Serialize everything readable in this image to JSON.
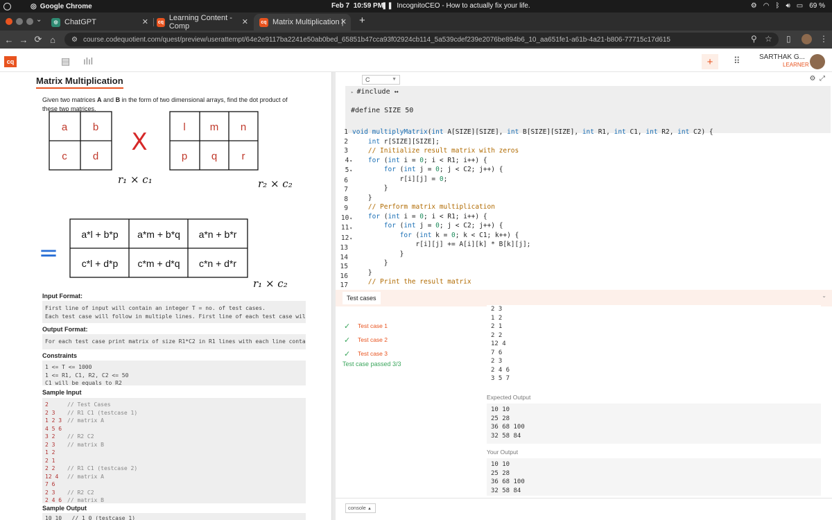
{
  "os": {
    "app_name": "Google Chrome",
    "date": "Feb 7",
    "time": "10:59 PM",
    "media": "IncognitoCEO - How to actually fix your life.",
    "battery": "69 %"
  },
  "tabs": [
    {
      "label": "ChatGPT",
      "icon": "chatgpt-icon",
      "favcolor": "#2f8a72"
    },
    {
      "label": "Learning Content - Comp",
      "icon": "cq-icon",
      "favcolor": "#e8531f"
    },
    {
      "label": "Matrix Multiplication | C",
      "icon": "cq-icon",
      "favcolor": "#e8531f"
    }
  ],
  "address": {
    "url": "course.codequotient.com/quest/preview/userattempt/64e2e9117ba2241e50ab0bed_65851b47cca93f02924cb114_5a539cdef239e2076be894b6_10_aa651fe1-a61b-4a21-b806-77715c17d615"
  },
  "header": {
    "logo": "cq",
    "user_name": "SARTHAK G...",
    "user_role": "LEARNER",
    "plus": "+"
  },
  "problem": {
    "title": "Matrix Multiplication",
    "description_a": "Given two matrices ",
    "bold_a": "A",
    "description_b": " and ",
    "bold_b": "B",
    "description_c": " in the form of two dimensional arrays, find the dot product of these two matrices.",
    "matrix_a": [
      "a",
      "b",
      "c",
      "d"
    ],
    "matrix_b": [
      "l",
      "m",
      "n",
      "p",
      "q",
      "r"
    ],
    "result": [
      "a*l + b*p",
      "a*m + b*q",
      "a*n + b*r",
      "c*l + d*p",
      "c*m + d*q",
      "c*n + d*r"
    ],
    "note_a": "r₁ × c₁",
    "note_b": "r₂ × c₂",
    "note_res": "r₁ × c₂",
    "times": "X",
    "equals": "=",
    "input_format_label": "Input Format:",
    "input_format_1": "First line of input will contain an integer T = no. of test cases.",
    "input_format_2": "Each test case will follow in multiple lines. First line of each test case will conta",
    "output_format_label": "Output Format:",
    "output_format_1": "For each test case print matrix of size R1*C2 in R1 lines with each line containing C2",
    "constraints_label": "Constraints",
    "constraints": [
      "1 <= T <= 1000",
      "1 <= R1, C1, R2, C2 <= 50",
      "C1 will be equals to R2"
    ],
    "sample_input_label": "Sample Input",
    "sample_input": [
      {
        "v": "2",
        "c": "// Test Cases"
      },
      {
        "v": "2 3",
        "c": "// R1 C1 (testcase 1)"
      },
      {
        "v": "1 2 3",
        "c": "// matrix A"
      },
      {
        "v": "4 5 6",
        "c": ""
      },
      {
        "v": "3 2",
        "c": "// R2 C2"
      },
      {
        "v": "2 3",
        "c": "// matrix B"
      },
      {
        "v": "1 2",
        "c": ""
      },
      {
        "v": "2 1",
        "c": ""
      },
      {
        "v": "2 2",
        "c": "// R1 C1 (testcase 2)"
      },
      {
        "v": "12 4",
        "c": "// matrix A"
      },
      {
        "v": "7 6",
        "c": ""
      },
      {
        "v": "2 3",
        "c": "// R2 C2"
      },
      {
        "v": "2 4 6",
        "c": "// matrix B"
      },
      {
        "v": "3 5 7",
        "c": ""
      }
    ],
    "sample_output_label": "Sample Output",
    "sample_output_first": "10 10   // 1 0 (testcase 1)"
  },
  "editor": {
    "language": "C",
    "header_lines": [
      "#include ↔",
      "",
      "#define SIZE 50"
    ],
    "code": [
      "void multiplyMatrix(int A[SIZE][SIZE], int B[SIZE][SIZE], int R1, int C1, int R2, int C2) {",
      "    int r[SIZE][SIZE];",
      "    // Initialize result matrix with zeros",
      "    for (int i = 0; i < R1; i++) {",
      "        for (int j = 0; j < C2; j++) {",
      "            r[i][j] = 0;",
      "        }",
      "    }",
      "    // Perform matrix multiplication",
      "    for (int i = 0; i < R1; i++) {",
      "        for (int j = 0; j < C2; j++) {",
      "            for (int k = 0; k < C1; k++) {",
      "                r[i][j] += A[i][k] * B[k][j];",
      "            }",
      "        }",
      "    }",
      "    // Print the result matrix"
    ],
    "folds": [
      4,
      5,
      10,
      11,
      12
    ]
  },
  "tests": {
    "tab_label": "Test cases",
    "items": [
      "Test case 1",
      "Test case 2",
      "Test case 3"
    ],
    "passed": "Test case passed 3/3",
    "input_text": "2 3\n1 2\n2 1\n2 2\n12 4\n7 6\n2 3\n2 4 6\n3 5 7",
    "expected_label": "Expected Output",
    "expected": "10 10\n25 28\n36 68 100\n32 58 84",
    "your_label": "Your Output",
    "your": "10 10\n25 28\n36 68 100\n32 58 84",
    "console_label": "console"
  }
}
